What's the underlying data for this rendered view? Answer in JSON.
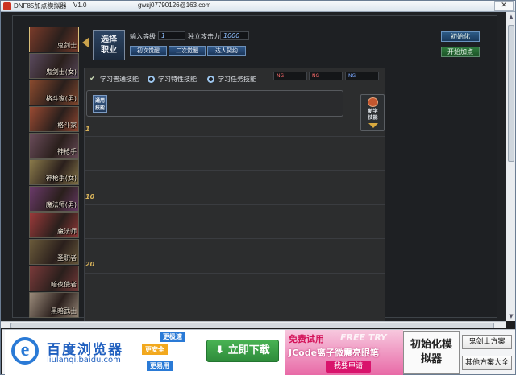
{
  "window": {
    "app_title": "DNF85加点模拟器",
    "version": "V1.0",
    "email": "gwsj07790126@163.com",
    "close_glyph": "✕"
  },
  "classes": [
    {
      "label": "鬼剑士",
      "color": "#7a3b2a"
    },
    {
      "label": "鬼剑士(女)",
      "color": "#5a4a5e"
    },
    {
      "label": "格斗家(男)",
      "color": "#8a4a2e"
    },
    {
      "label": "格斗家",
      "color": "#9a4a32"
    },
    {
      "label": "神枪手",
      "color": "#6a4c5a"
    },
    {
      "label": "神枪手(女)",
      "color": "#8a7a4a"
    },
    {
      "label": "魔法师(男)",
      "color": "#6a3a6a"
    },
    {
      "label": "魔法师",
      "color": "#9a3a3a"
    },
    {
      "label": "圣职者",
      "color": "#6a5a3a"
    },
    {
      "label": "暗夜使者",
      "color": "#7a3a3a"
    },
    {
      "label": "黑暗武士",
      "color": "#9a8a7a"
    }
  ],
  "select_class": {
    "line1": "选择",
    "line2": "职业"
  },
  "level": {
    "label": "输入等级",
    "value": "1"
  },
  "attack": {
    "label": "独立攻击力",
    "value": "1000"
  },
  "advancement": [
    "初次觉醒",
    "二次觉醒",
    "达人契约"
  ],
  "right_buttons": {
    "init": "初始化",
    "start": "开始加点"
  },
  "options": {
    "normal": "学习普通技能",
    "special": "学习特性技能",
    "quest": "学习任务技能"
  },
  "mini_boxes": [
    "NG",
    "NG",
    "NG"
  ],
  "general_skill": {
    "line1": "通用",
    "line2": "技能"
  },
  "learn_panel": {
    "line1": "新学",
    "line2": "技能"
  },
  "levels": [
    "1",
    "10",
    "20"
  ],
  "ads": {
    "baidu_name": "百度浏览器",
    "baidu_url": "liulanqi.baidu.com",
    "badge_fast": "更极速",
    "badge_safe": "更安全",
    "badge_easy": "更易用",
    "download": "立即下载",
    "jcode_l1": "免费试用",
    "jcode_l1b": "FREE TRY",
    "jcode_l2": "JCode离子微震亮眼笔",
    "jcode_btn": "我要申请"
  },
  "init_sim": {
    "line1": "初始化模",
    "line2": "拟器"
  },
  "side_buttons": [
    "鬼剑士方案",
    "其他方案大全"
  ]
}
